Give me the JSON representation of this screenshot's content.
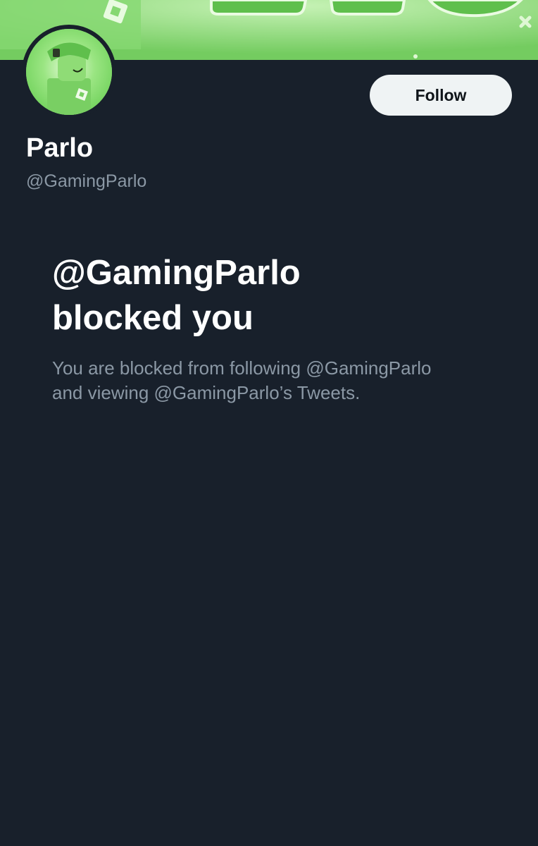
{
  "profile": {
    "display_name": "Parlo",
    "handle": "@GamingParlo",
    "follow_label": "Follow"
  },
  "blocked_notice": {
    "title_line1": "@GamingParlo",
    "title_line2": "blocked you",
    "description_line1": "You are blocked from following @GamingParlo",
    "description_line2": "and viewing @GamingParlo’s Tweets."
  },
  "colors": {
    "background": "#18202b",
    "banner_green": "#7fd46a",
    "follow_button_bg": "#eff3f4",
    "primary_text": "#ffffff",
    "secondary_text": "#8b98a5"
  }
}
